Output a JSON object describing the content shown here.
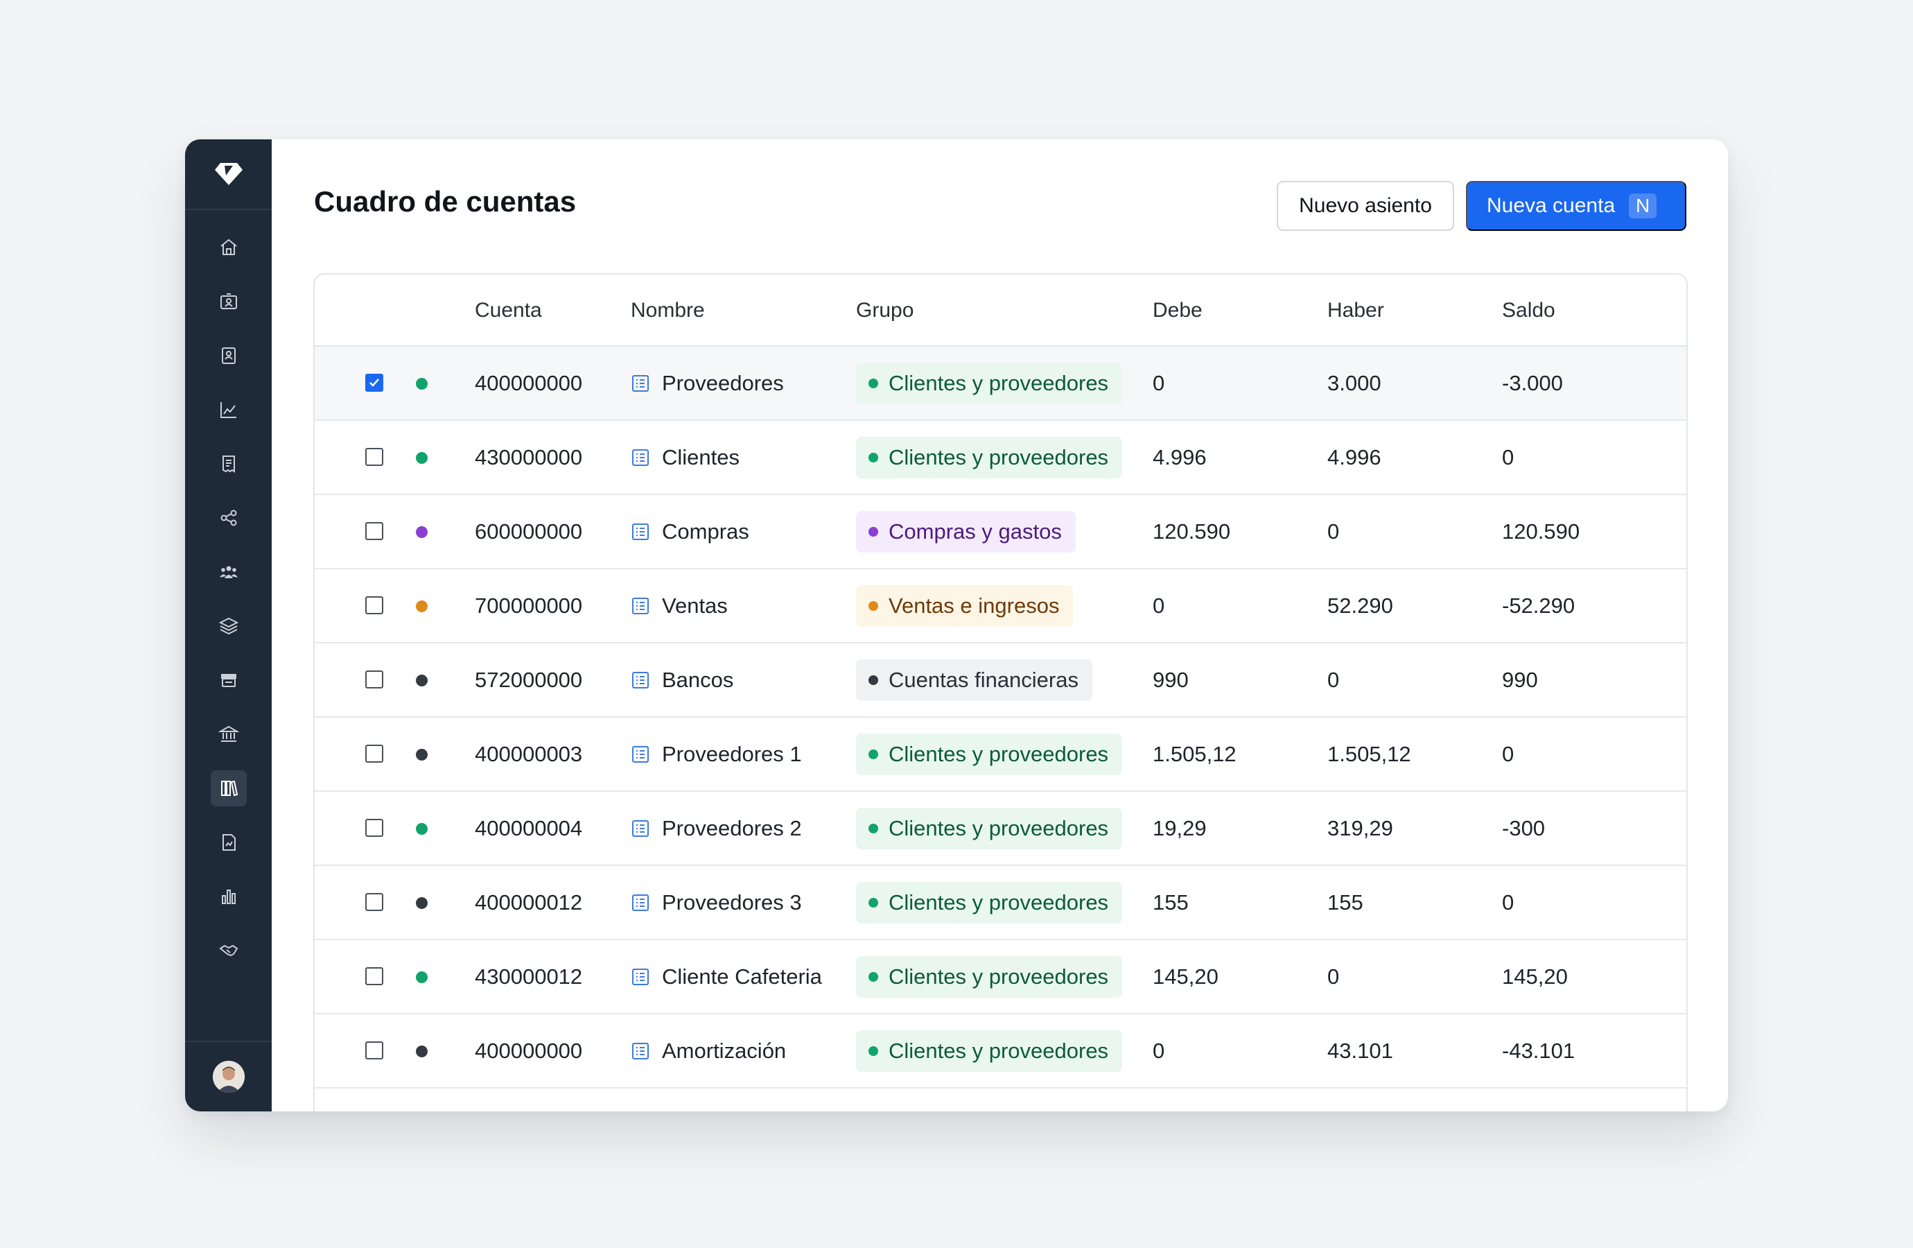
{
  "colors": {
    "sidebar_bg": "#1f2a38",
    "primary": "#1a68f0",
    "green": "#11a36b",
    "purple": "#8a3fd1",
    "orange": "#e08a1c",
    "dark": "#343a42"
  },
  "sidebar": {
    "logo": "diamond-logo",
    "items": [
      {
        "icon": "home-icon"
      },
      {
        "icon": "id-card-icon"
      },
      {
        "icon": "contact-book-icon"
      },
      {
        "icon": "trend-chart-icon"
      },
      {
        "icon": "receipt-icon"
      },
      {
        "icon": "share-nodes-icon"
      },
      {
        "icon": "team-icon"
      },
      {
        "icon": "layers-icon"
      },
      {
        "icon": "cash-register-icon"
      },
      {
        "icon": "bank-icon"
      },
      {
        "icon": "books-icon",
        "active": true
      },
      {
        "icon": "document-chart-icon"
      },
      {
        "icon": "bar-chart-icon"
      },
      {
        "icon": "handshake-icon"
      }
    ],
    "user_avatar": "user-avatar"
  },
  "header": {
    "title": "Cuadro de cuentas",
    "secondary_button": "Nuevo asiento",
    "primary_button": "Nueva cuenta",
    "primary_shortcut": "N"
  },
  "table": {
    "columns": [
      "Cuenta",
      "Nombre",
      "Grupo",
      "Debe",
      "Haber",
      "Saldo"
    ],
    "rows": [
      {
        "checked": true,
        "dot": "green",
        "cuenta": "400000000",
        "nombre": "Proveedores",
        "grupo": "Clientes y proveedores",
        "grupo_style": "green",
        "debe": "0",
        "haber": "3.000",
        "saldo": "-3.000"
      },
      {
        "checked": false,
        "dot": "green",
        "cuenta": "430000000",
        "nombre": "Clientes",
        "grupo": "Clientes y proveedores",
        "grupo_style": "green",
        "debe": "4.996",
        "haber": "4.996",
        "saldo": "0"
      },
      {
        "checked": false,
        "dot": "purple",
        "cuenta": "600000000",
        "nombre": "Compras",
        "grupo": "Compras y gastos",
        "grupo_style": "purple",
        "debe": "120.590",
        "haber": "0",
        "saldo": "120.590"
      },
      {
        "checked": false,
        "dot": "orange",
        "cuenta": "700000000",
        "nombre": "Ventas",
        "grupo": "Ventas e ingresos",
        "grupo_style": "orange",
        "debe": "0",
        "haber": "52.290",
        "saldo": "-52.290"
      },
      {
        "checked": false,
        "dot": "dark",
        "cuenta": "572000000",
        "nombre": "Bancos",
        "grupo": "Cuentas financieras",
        "grupo_style": "gray",
        "debe": "990",
        "haber": "0",
        "saldo": "990"
      },
      {
        "checked": false,
        "dot": "dark",
        "cuenta": "400000003",
        "nombre": "Proveedores 1",
        "grupo": "Clientes y proveedores",
        "grupo_style": "green",
        "debe": "1.505,12",
        "haber": "1.505,12",
        "saldo": "0"
      },
      {
        "checked": false,
        "dot": "green",
        "cuenta": "400000004",
        "nombre": "Proveedores 2",
        "grupo": "Clientes y proveedores",
        "grupo_style": "green",
        "debe": "19,29",
        "haber": "319,29",
        "saldo": "-300"
      },
      {
        "checked": false,
        "dot": "dark",
        "cuenta": "400000012",
        "nombre": "Proveedores 3",
        "grupo": "Clientes y proveedores",
        "grupo_style": "green",
        "debe": "155",
        "haber": "155",
        "saldo": "0"
      },
      {
        "checked": false,
        "dot": "green",
        "cuenta": "430000012",
        "nombre": "Cliente Cafeteria",
        "grupo": "Clientes y proveedores",
        "grupo_style": "green",
        "debe": "145,20",
        "haber": "0",
        "saldo": "145,20"
      },
      {
        "checked": false,
        "dot": "dark",
        "cuenta": "400000000",
        "nombre": "Amortización",
        "grupo": "Clientes y proveedores",
        "grupo_style": "green",
        "debe": "0",
        "haber": "43.101",
        "saldo": "-43.101"
      }
    ]
  }
}
